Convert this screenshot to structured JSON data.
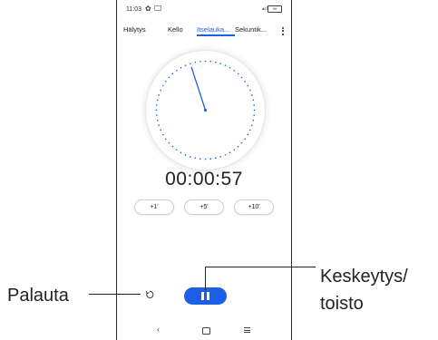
{
  "status_bar": {
    "time": "11:03",
    "battery": "99"
  },
  "tabs": [
    {
      "label": "Hälytys",
      "active": false
    },
    {
      "label": "Kello",
      "active": false
    },
    {
      "label": "Itselauka...",
      "active": true
    },
    {
      "label": "Sekuntik...",
      "active": false
    }
  ],
  "stopwatch": {
    "elapsed": "00:00:57",
    "hand_seconds": 57
  },
  "lap_buttons": [
    {
      "label": "+1'"
    },
    {
      "label": "+5'"
    },
    {
      "label": "+10'"
    }
  ],
  "callouts": {
    "reset": "Palauta",
    "pause_line1": "Keskeytys/",
    "pause_line2": "toisto"
  },
  "colors": {
    "accent": "#1b5fe6",
    "text": "#222222"
  },
  "icons": {
    "settings": "gear-icon",
    "reset": "reset-icon",
    "pause": "pause-icon",
    "menu": "kebab-menu-icon",
    "back": "back-icon",
    "home": "home-icon",
    "recents": "recents-icon"
  }
}
